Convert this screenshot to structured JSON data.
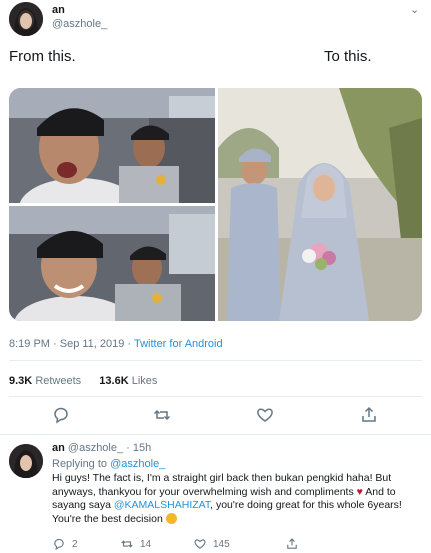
{
  "author": {
    "name": "an",
    "handle": "@aszhole_"
  },
  "tweet": {
    "caption_left": "From this.",
    "caption_right": "To this.",
    "meta_time": "8:19 PM · Sep 11, 2019 · ",
    "meta_source": "Twitter for Android",
    "retweets": "9.3K",
    "retweets_label": "Retweets",
    "likes": "13.6K",
    "likes_label": "Likes"
  },
  "reply": {
    "name": "an",
    "handle_time": "@aszhole_ · 15h",
    "replying_to_label": "Replying to",
    "replying_to_handle": "@aszhole_",
    "text_1": "Hi guys! The fact is, I'm a straight girl back then bukan pengkid haha! But anyways, thankyou for your overwhelming wish and compliments",
    "text_2": "And to sayang saya",
    "mention": "@KAMALSHAHIZAT",
    "text_3": ", you're doing great for this whole 6years! You're the best decision",
    "heart_emoji": "♥",
    "replies_count": "2",
    "retweets_count": "14",
    "likes_count": "145"
  },
  "icons": {
    "caret": "chevron-down-icon",
    "reply": "reply-icon",
    "retweet": "retweet-icon",
    "like": "heart-icon",
    "share": "share-icon"
  },
  "colors": {
    "link": "#1b95e0",
    "muted": "#657786",
    "text": "#14171a",
    "heart": "#c0152f"
  }
}
